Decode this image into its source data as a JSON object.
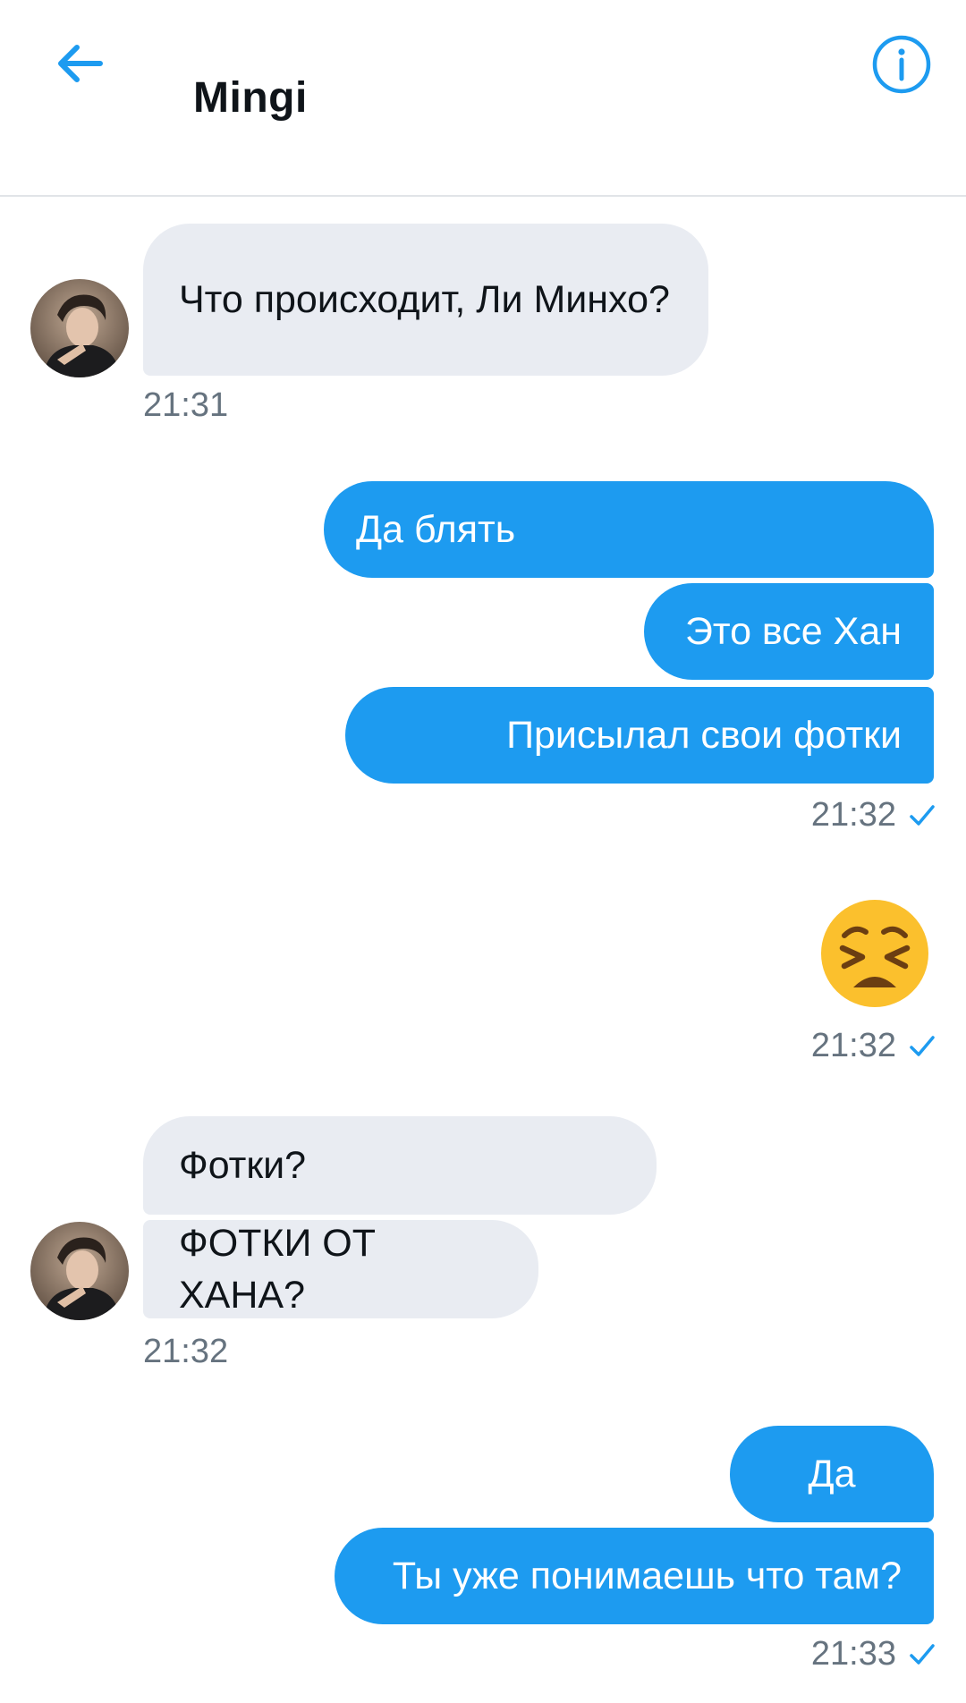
{
  "header": {
    "title": "Mingi",
    "back_icon": "arrow-left-icon",
    "info_icon": "info-circle-icon"
  },
  "colors": {
    "accent": "#1d9bf0",
    "incoming_bubble": "#e9ecf2",
    "timestamp": "#66737f"
  },
  "messages": [
    {
      "from": "contact",
      "text": "Что происходит, Ли Минхо?",
      "time": "21:31"
    },
    {
      "from": "me",
      "text": "Да блять"
    },
    {
      "from": "me",
      "text": "Это все Хан"
    },
    {
      "from": "me",
      "text": "Присылал свои фотки",
      "time": "21:32",
      "status": "sent-check-icon"
    },
    {
      "from": "me",
      "emoji": "persevering-face-emoji",
      "time": "21:32",
      "status": "sent-check-icon"
    },
    {
      "from": "contact",
      "text": "Фотки?"
    },
    {
      "from": "contact",
      "text": "ФОТКИ ОТ ХАНА?",
      "time": "21:32"
    },
    {
      "from": "me",
      "text": "Да"
    },
    {
      "from": "me",
      "text": "Ты уже понимаешь что там?",
      "time": "21:33",
      "status": "sent-check-icon"
    }
  ]
}
